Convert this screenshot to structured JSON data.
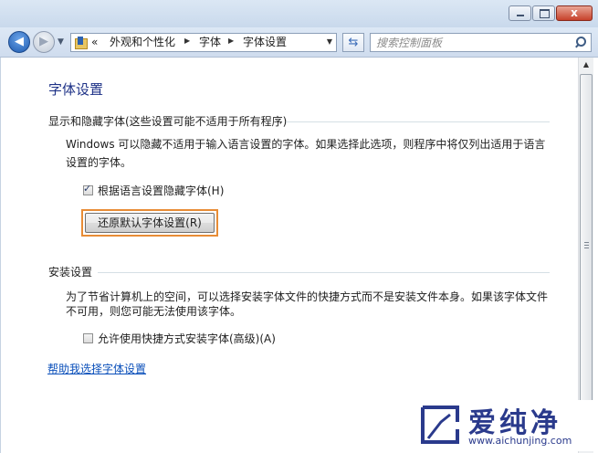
{
  "window": {
    "min_label": "",
    "max_label": "",
    "close_label": "x"
  },
  "nav": {
    "back_label": "◀",
    "forward_label": "▶"
  },
  "address": {
    "overflow": "«",
    "crumbs": [
      "外观和个性化",
      "字体",
      "字体设置"
    ]
  },
  "search": {
    "placeholder": "搜索控制面板"
  },
  "page": {
    "title": "字体设置",
    "group1": {
      "header": "显示和隐藏字体(这些设置可能不适用于所有程序)",
      "desc_line1": "Windows 可以隐藏不适用于输入语言设置的字体。如果选择此选项，则程序中将仅列出适用于语言",
      "desc_line2": "设置的字体。",
      "checkbox_label": "根据语言设置隐藏字体(H)",
      "checkbox_checked": true,
      "restore_button": "还原默认字体设置(R)"
    },
    "group2": {
      "header": "安装设置",
      "desc_line1": "为了节省计算机上的空间，可以选择安装字体文件的快捷方式而不是安装文件本身。如果该字体文件",
      "desc_line2": "不可用，则您可能无法使用该字体。",
      "checkbox_label": "允许使用快捷方式安装字体(高级)(A)",
      "checkbox_checked": false
    },
    "help_link": "帮助我选择字体设置"
  },
  "watermark": {
    "brand_cn": "爱纯净",
    "url": "www.aichunjing.com"
  },
  "colors": {
    "title_blue": "#1e3287",
    "link_blue": "#0a4fba",
    "highlight_orange": "#e88c35"
  }
}
